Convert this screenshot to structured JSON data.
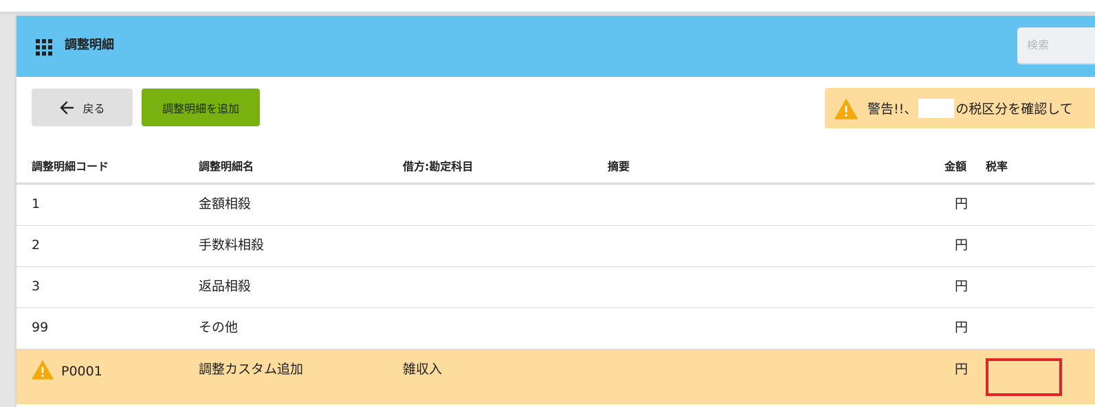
{
  "header": {
    "title": "調整明細",
    "search_placeholder": "検索"
  },
  "toolbar": {
    "back_label": "戻る",
    "add_label": "調整明細を追加"
  },
  "warning": {
    "prefix": "警告!!、",
    "suffix": "の税区分を確認して"
  },
  "table": {
    "columns": {
      "code": "調整明細コード",
      "name": "調整明細名",
      "debit": "借方:勘定科目",
      "memo": "摘要",
      "amount": "金額",
      "tax": "税率"
    },
    "rows": [
      {
        "code": "1",
        "name": "金額相殺",
        "debit": "",
        "memo": "",
        "amount": "円",
        "tax": ""
      },
      {
        "code": "2",
        "name": "手数料相殺",
        "debit": "",
        "memo": "",
        "amount": "円",
        "tax": ""
      },
      {
        "code": "3",
        "name": "返品相殺",
        "debit": "",
        "memo": "",
        "amount": "円",
        "tax": ""
      },
      {
        "code": "99",
        "name": "その他",
        "debit": "",
        "memo": "",
        "amount": "円",
        "tax": ""
      },
      {
        "code": "P0001",
        "name": "調整カスタム追加",
        "debit": "雑収入",
        "memo": "",
        "amount": "円",
        "tax": "",
        "warning": true
      }
    ]
  },
  "colors": {
    "header_bg": "#62c3f1",
    "add_button": "#79b10e",
    "warning_bg": "#fddc9e",
    "warning_icon": "#f5a80a",
    "highlight_border": "#e0242b"
  },
  "icons": {
    "menu": "grid-icon",
    "back": "arrow-left-icon",
    "warning": "warning-icon"
  }
}
